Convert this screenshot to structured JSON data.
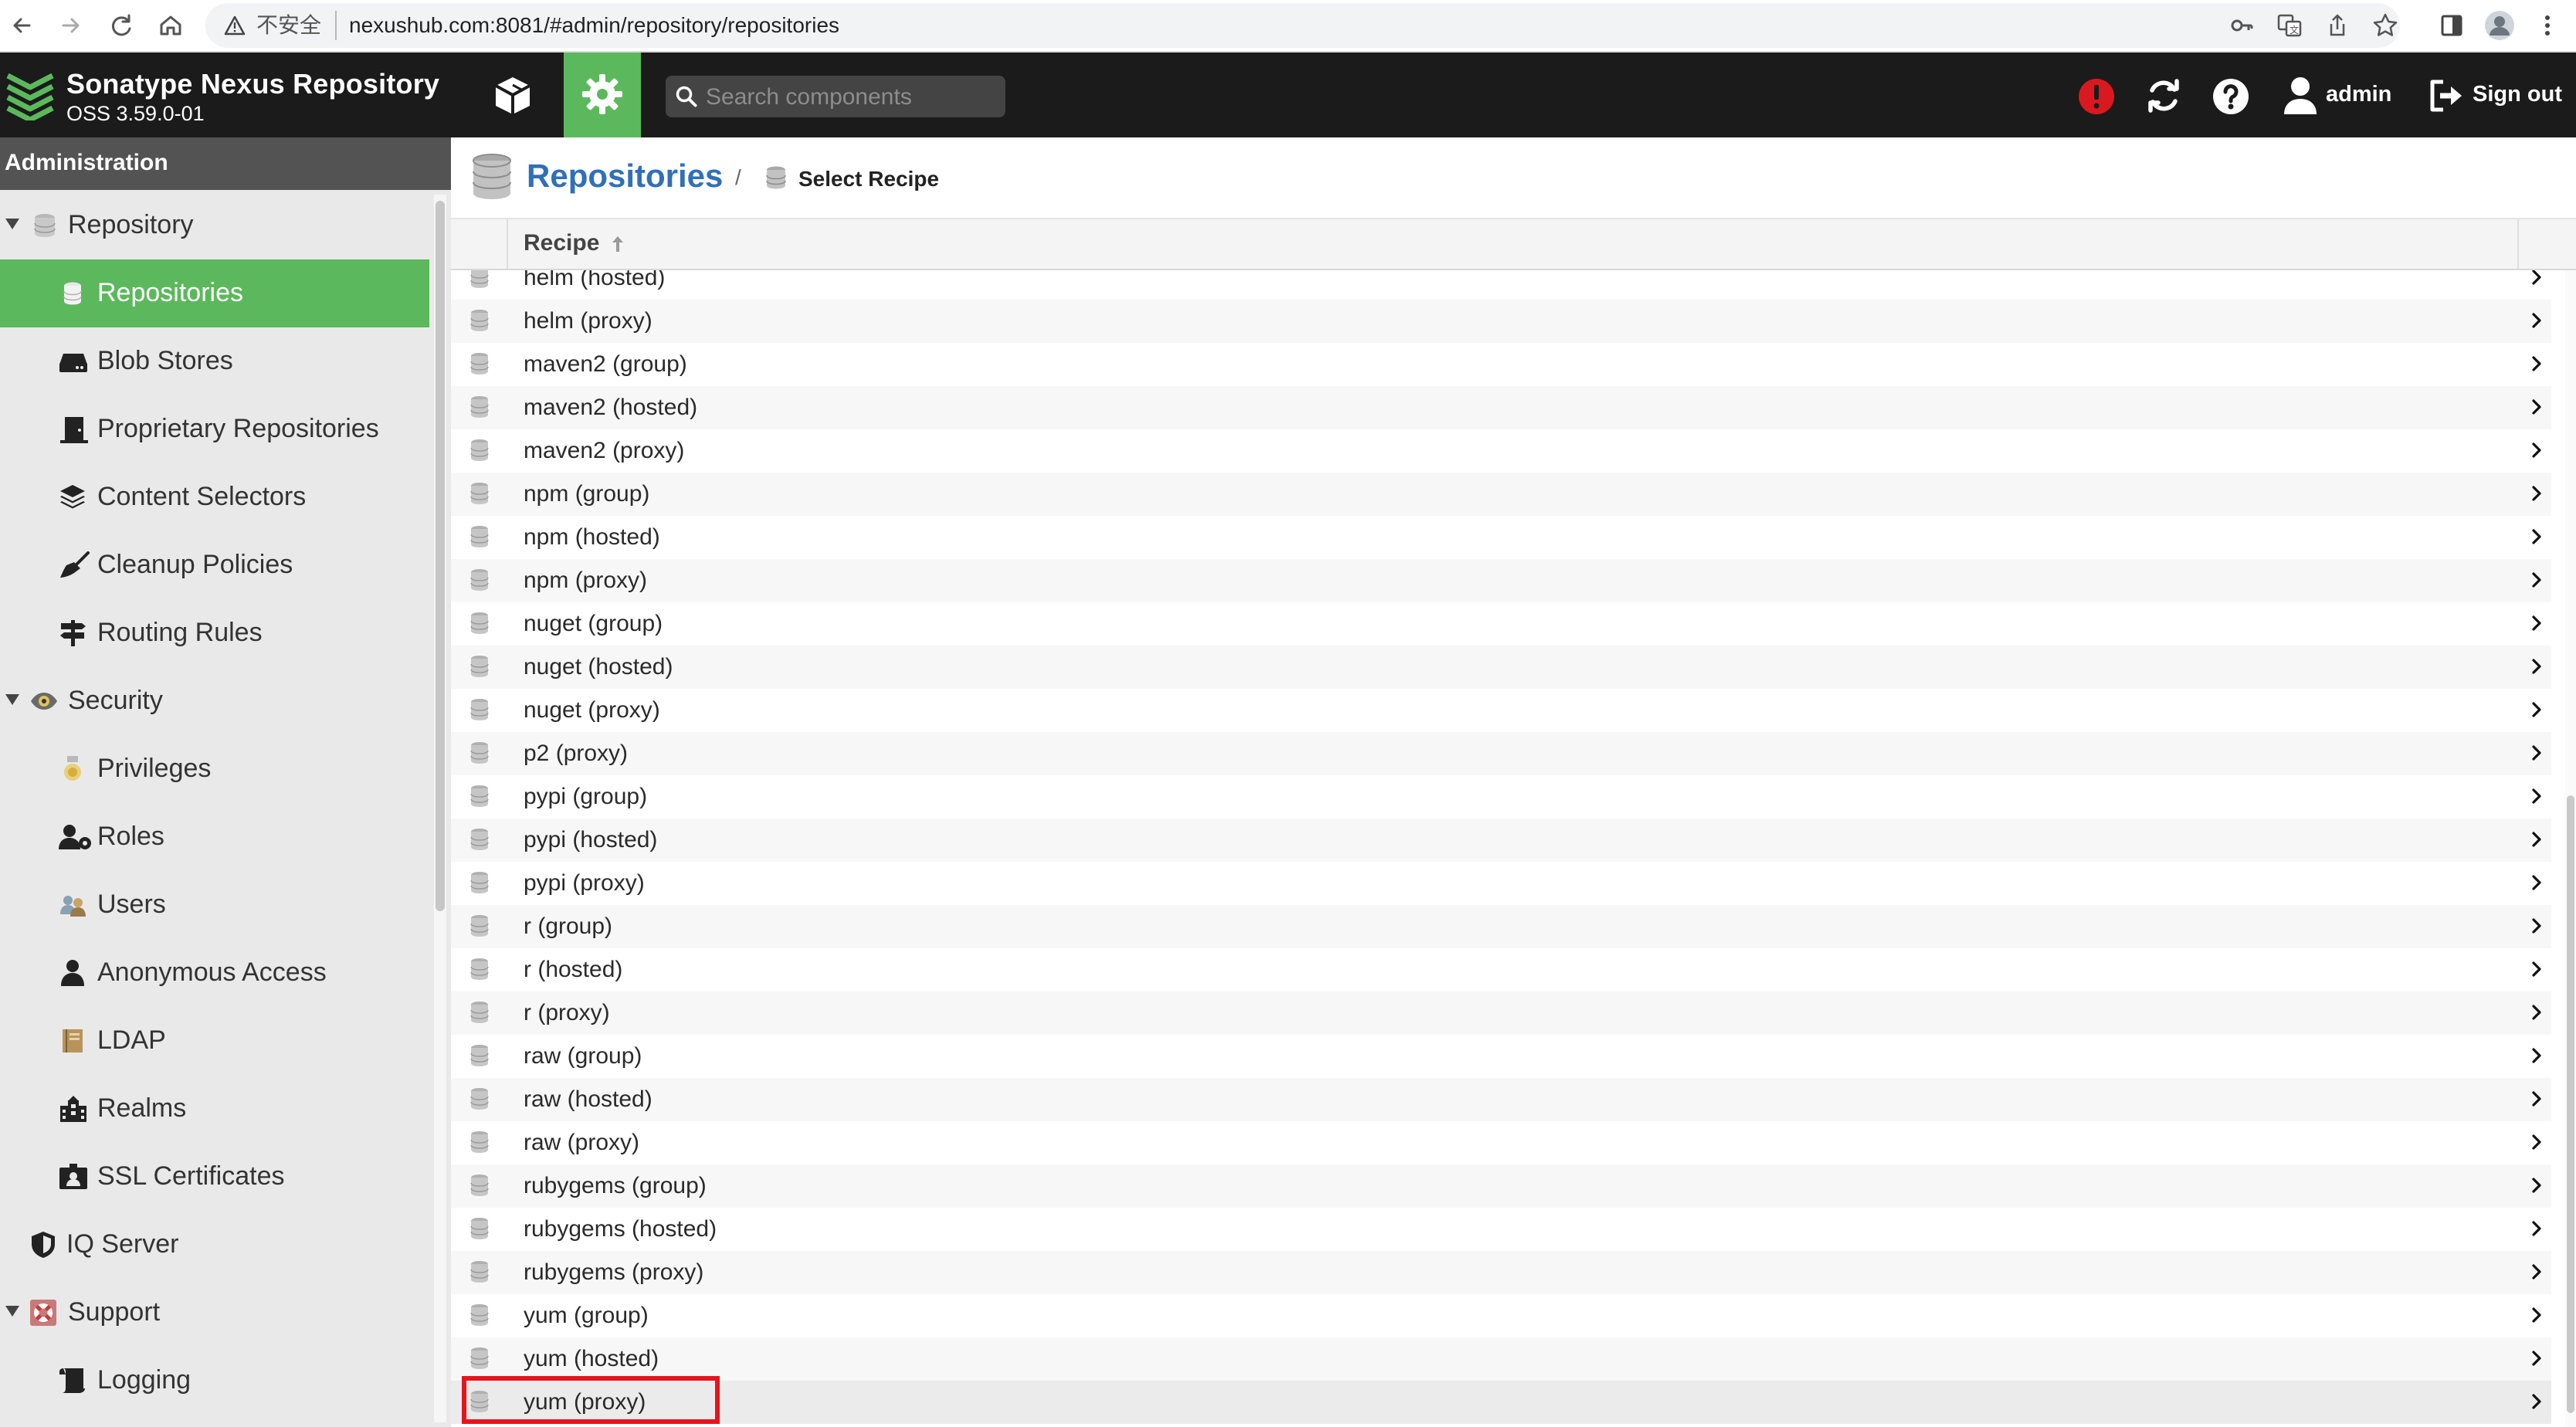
{
  "browser": {
    "security_label": "不安全",
    "url": "nexushub.com:8081/#admin/repository/repositories"
  },
  "header": {
    "app_title": "Sonatype Nexus Repository",
    "app_version": "OSS 3.59.0-01",
    "search_placeholder": "Search components",
    "user_name": "admin",
    "sign_out_label": "Sign out",
    "accent_color": "#5cb85c",
    "alert_color": "#d9191f"
  },
  "sidebar": {
    "heading": "Administration",
    "items": [
      {
        "label": "Repository",
        "icon": "database-icon",
        "level": 0,
        "expanded": true
      },
      {
        "label": "Repositories",
        "icon": "database-icon",
        "level": 1,
        "selected": true
      },
      {
        "label": "Blob Stores",
        "icon": "hard-drive-icon",
        "level": 1
      },
      {
        "label": "Proprietary Repositories",
        "icon": "door-icon",
        "level": 1
      },
      {
        "label": "Content Selectors",
        "icon": "layers-icon",
        "level": 1
      },
      {
        "label": "Cleanup Policies",
        "icon": "broom-icon",
        "level": 1
      },
      {
        "label": "Routing Rules",
        "icon": "signpost-icon",
        "level": 1
      },
      {
        "label": "Security",
        "icon": "eye-icon",
        "level": 0,
        "expanded": true
      },
      {
        "label": "Privileges",
        "icon": "medal-icon",
        "level": 1
      },
      {
        "label": "Roles",
        "icon": "user-gear-icon",
        "level": 1
      },
      {
        "label": "Users",
        "icon": "users-icon",
        "level": 1
      },
      {
        "label": "Anonymous Access",
        "icon": "user-icon",
        "level": 1
      },
      {
        "label": "LDAP",
        "icon": "book-icon",
        "level": 1
      },
      {
        "label": "Realms",
        "icon": "building-icon",
        "level": 1
      },
      {
        "label": "SSL Certificates",
        "icon": "id-card-icon",
        "level": 1
      },
      {
        "label": "IQ Server",
        "icon": "shield-icon",
        "level": 0
      },
      {
        "label": "Support",
        "icon": "lifebuoy-icon",
        "level": 0,
        "expanded": true
      },
      {
        "label": "Logging",
        "icon": "scroll-icon",
        "level": 1
      }
    ]
  },
  "breadcrumb": {
    "title": "Repositories",
    "separator": "/",
    "current": "Select Recipe"
  },
  "grid": {
    "column_header": "Recipe",
    "sort_direction": "ascending",
    "rows": [
      "helm (hosted)",
      "helm (proxy)",
      "maven2 (group)",
      "maven2 (hosted)",
      "maven2 (proxy)",
      "npm (group)",
      "npm (hosted)",
      "npm (proxy)",
      "nuget (group)",
      "nuget (hosted)",
      "nuget (proxy)",
      "p2 (proxy)",
      "pypi (group)",
      "pypi (hosted)",
      "pypi (proxy)",
      "r (group)",
      "r (hosted)",
      "r (proxy)",
      "raw (group)",
      "raw (hosted)",
      "raw (proxy)",
      "rubygems (group)",
      "rubygems (hosted)",
      "rubygems (proxy)",
      "yum (group)",
      "yum (hosted)",
      "yum (proxy)"
    ],
    "highlighted_row": "yum (proxy)"
  }
}
